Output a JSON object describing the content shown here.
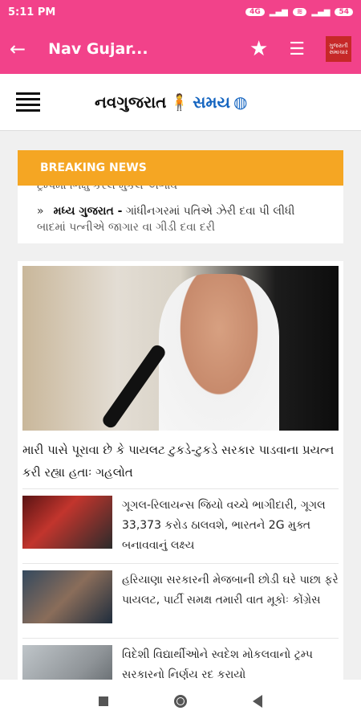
{
  "status": {
    "time": "5:11 PM",
    "network1": "4G",
    "battery": "54"
  },
  "toolbar": {
    "title": "Nav Gujar...",
    "app_logo_text": "ગુજરાતી સમાચાર"
  },
  "site": {
    "brand_left": "નવગુજરાત",
    "brand_right": "સમય"
  },
  "breaking": {
    "label": "BREAKING NEWS",
    "cut_text": "ટ્રમ્પમાં ભિક્ષુ કરેલ મુકેલ અભાવ",
    "items": [
      {
        "region": "મધ્ય ગુજરાત -",
        "text": "ગાંધીનગરમાં પતિએ ઝેરી દવા પી લીધી",
        "text2": "બાદમાં પત્નીએ જાગાર વા ગીડી દવા દરી"
      }
    ]
  },
  "hero": {
    "title": "મારી પાસે પૂરાવા છે કે પાયલટ ટુકડે-ટુકડે સરકાર પાડવાના પ્રયત્ન કરી રહ્યા હતાઃ ગહલોત"
  },
  "news": [
    {
      "title": "ગૂગલ-રિલાયન્સ જિયો વચ્ચે ભાગીદારી, ગૂગલ 33,373 કરોડ ઠાલવશે, ભારતને 2G મુક્ત બનાવવાનું લક્ષ્ય"
    },
    {
      "title": "હરિયાણા સરકારની મેજબાની છોડી ઘરે પાછા ફરે પાયલટ, પાર્ટી સમક્ષ તમારી વાત મૂકોઃ કોંગ્રેસ"
    },
    {
      "title": "વિદેશી વિદ્યાર્થીઓને સ્વદેશ મોકલવાનો ટ્રમ્પ સરકારનો નિર્ણય રદ કરાયો"
    }
  ]
}
